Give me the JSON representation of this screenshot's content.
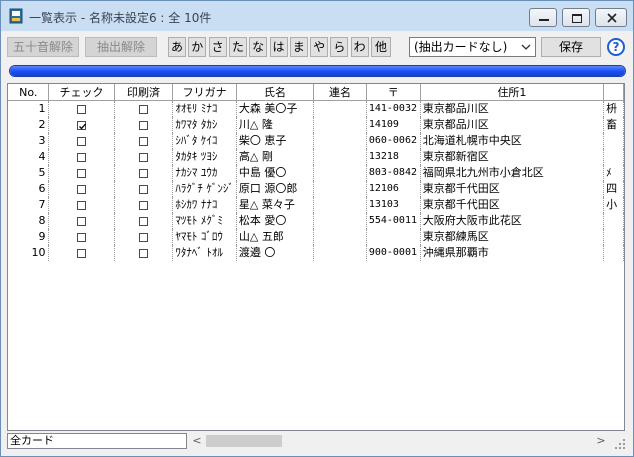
{
  "window": {
    "title": "一覧表示 - 名称未設定6 : 全 10件"
  },
  "toolbar": {
    "gojuon_clear": "五十音解除",
    "extract_clear": "抽出解除",
    "kana": [
      "あ",
      "か",
      "さ",
      "た",
      "な",
      "は",
      "ま",
      "や",
      "ら",
      "わ",
      "他"
    ],
    "extract_card_select": "(抽出カードなし)",
    "save_label": "保存",
    "help_label": "?"
  },
  "progress": {
    "value": 1.0,
    "color": "#1a4ef0"
  },
  "table": {
    "columns": [
      "No.",
      "チェック",
      "印刷済",
      "フリガナ",
      "氏名",
      "連名",
      "〒",
      "住所1",
      ""
    ],
    "rows": [
      {
        "no": "1",
        "check": false,
        "printed": false,
        "furigana": "ｵｵﾓﾘ ﾐﾅｺ",
        "name": "大森 美〇子",
        "renmei": "",
        "zip": "141-0032",
        "address": "東京都品川区",
        "extra": "枡"
      },
      {
        "no": "2",
        "check": true,
        "printed": false,
        "furigana": "ｶﾜﾏﾀ ﾀｶｼ",
        "name": "川△ 隆",
        "renmei": "",
        "zip": "14109",
        "address": "東京都品川区",
        "extra": "畜"
      },
      {
        "no": "3",
        "check": false,
        "printed": false,
        "furigana": "ｼﾊﾞﾀ ｹｲｺ",
        "name": "柴〇 恵子",
        "renmei": "",
        "zip": "060-0062",
        "address": "北海道札幌市中央区",
        "extra": ""
      },
      {
        "no": "4",
        "check": false,
        "printed": false,
        "furigana": "ﾀｶﾀｷ ﾂﾖｼ",
        "name": "高△ 剛",
        "renmei": "",
        "zip": "13218",
        "address": "東京都新宿区",
        "extra": ""
      },
      {
        "no": "5",
        "check": false,
        "printed": false,
        "furigana": "ﾅｶｼﾏ ﾕｳｶ",
        "name": "中島 優〇",
        "renmei": "",
        "zip": "803-0842",
        "address": "福岡県北九州市小倉北区",
        "extra": "ﾒ"
      },
      {
        "no": "6",
        "check": false,
        "printed": false,
        "furigana": "ﾊﾗｸﾞﾁ ｹﾞﾝｼﾞ",
        "name": "原口 源〇郎",
        "renmei": "",
        "zip": "12106",
        "address": "東京都千代田区",
        "extra": "四"
      },
      {
        "no": "7",
        "check": false,
        "printed": false,
        "furigana": "ﾎｼｶﾜ ﾅﾅｺ",
        "name": "星△ 菜々子",
        "renmei": "",
        "zip": "13103",
        "address": "東京都千代田区",
        "extra": "小"
      },
      {
        "no": "8",
        "check": false,
        "printed": false,
        "furigana": "ﾏﾂﾓﾄ ﾒｸﾞﾐ",
        "name": "松本 愛〇",
        "renmei": "",
        "zip": "554-0011",
        "address": "大阪府大阪市此花区",
        "extra": ""
      },
      {
        "no": "9",
        "check": false,
        "printed": false,
        "furigana": "ﾔﾏﾓﾄ ｺﾞﾛｳ",
        "name": "山△ 五郎",
        "renmei": "",
        "zip": "",
        "address": "東京都練馬区",
        "extra": ""
      },
      {
        "no": "10",
        "check": false,
        "printed": false,
        "furigana": "ﾜﾀﾅﾍﾞ ﾄｵﾙ",
        "name": "渡邉 〇",
        "renmei": "",
        "zip": "900-0001",
        "address": "沖縄県那覇市",
        "extra": ""
      }
    ]
  },
  "status": {
    "card_set": "全カード"
  },
  "icons": {
    "app": "address-book-icon",
    "minimize": "minimize-icon",
    "maximize": "maximize-icon",
    "close": "close-icon",
    "dropdown": "chevron-down-icon",
    "help": "help-icon",
    "scroll_left": "chevron-left-icon",
    "scroll_right": "chevron-right-icon",
    "resize": "resize-grip-icon"
  },
  "colors": {
    "titlebar": "#c9ddf3",
    "progress": "#1a4ef0",
    "help": "#1d5fd0"
  }
}
